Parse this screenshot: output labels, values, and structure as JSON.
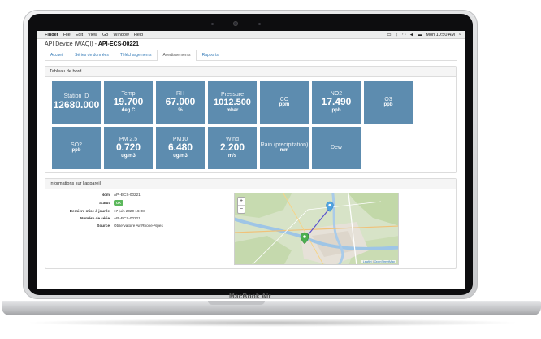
{
  "laptop_brand": "MacBook Air",
  "menubar": {
    "app": "Finder",
    "items": [
      "File",
      "Edit",
      "View",
      "Go",
      "Window",
      "Help"
    ],
    "clock": "Mon 10:50 AM"
  },
  "page": {
    "title_prefix": "API Device (WAQI) - ",
    "title_device": "API-ECS-00221"
  },
  "tabs": [
    {
      "label": "Accueil"
    },
    {
      "label": "Séries de données"
    },
    {
      "label": "Téléchargements"
    },
    {
      "label": "Avertissements"
    },
    {
      "label": "Rapports"
    }
  ],
  "dashboard": {
    "title": "Tableau de bord",
    "tiles": [
      {
        "label": "Station ID",
        "value": "12680.000",
        "unit": ""
      },
      {
        "label": "Temp",
        "value": "19.700",
        "unit": "deg C"
      },
      {
        "label": "RH",
        "value": "67.000",
        "unit": "%"
      },
      {
        "label": "Pressure",
        "value": "1012.500",
        "unit": "mbar"
      },
      {
        "label": "CO",
        "value": "",
        "unit": "ppm"
      },
      {
        "label": "NO2",
        "value": "17.490",
        "unit": "ppb"
      },
      {
        "label": "O3",
        "value": "",
        "unit": "ppb"
      },
      {
        "label": "SO2",
        "value": "",
        "unit": "ppb"
      },
      {
        "label": "PM 2.5",
        "value": "0.720",
        "unit": "ug/m3"
      },
      {
        "label": "PM10",
        "value": "6.480",
        "unit": "ug/m3"
      },
      {
        "label": "Wind",
        "value": "2.200",
        "unit": "m/s"
      },
      {
        "label": "Rain (precipitation)",
        "value": "",
        "unit": "mm"
      },
      {
        "label": "Dew",
        "value": "",
        "unit": ""
      }
    ]
  },
  "device_info": {
    "title": "Informations sur l'appareil",
    "rows": [
      {
        "key": "Nom",
        "value": "API-ECS-00221"
      },
      {
        "key": "Statut",
        "value": "OK"
      },
      {
        "key": "Dernière mise à jour le",
        "value": "17 juin 2020 16:08"
      },
      {
        "key": "Numéro de série",
        "value": "API-ECS-00221"
      },
      {
        "key": "Source",
        "value": "Observatoire Air Rhone-Alpes"
      }
    ]
  },
  "map": {
    "zoom_in": "+",
    "zoom_out": "−",
    "attribution_link": "Leaflet",
    "attribution_sep": " | ",
    "attribution_tiles": "OpenStreetMap"
  },
  "colors": {
    "tile": "#5d8caf",
    "status_ok": "#5cb85c",
    "link": "#337ab7"
  }
}
